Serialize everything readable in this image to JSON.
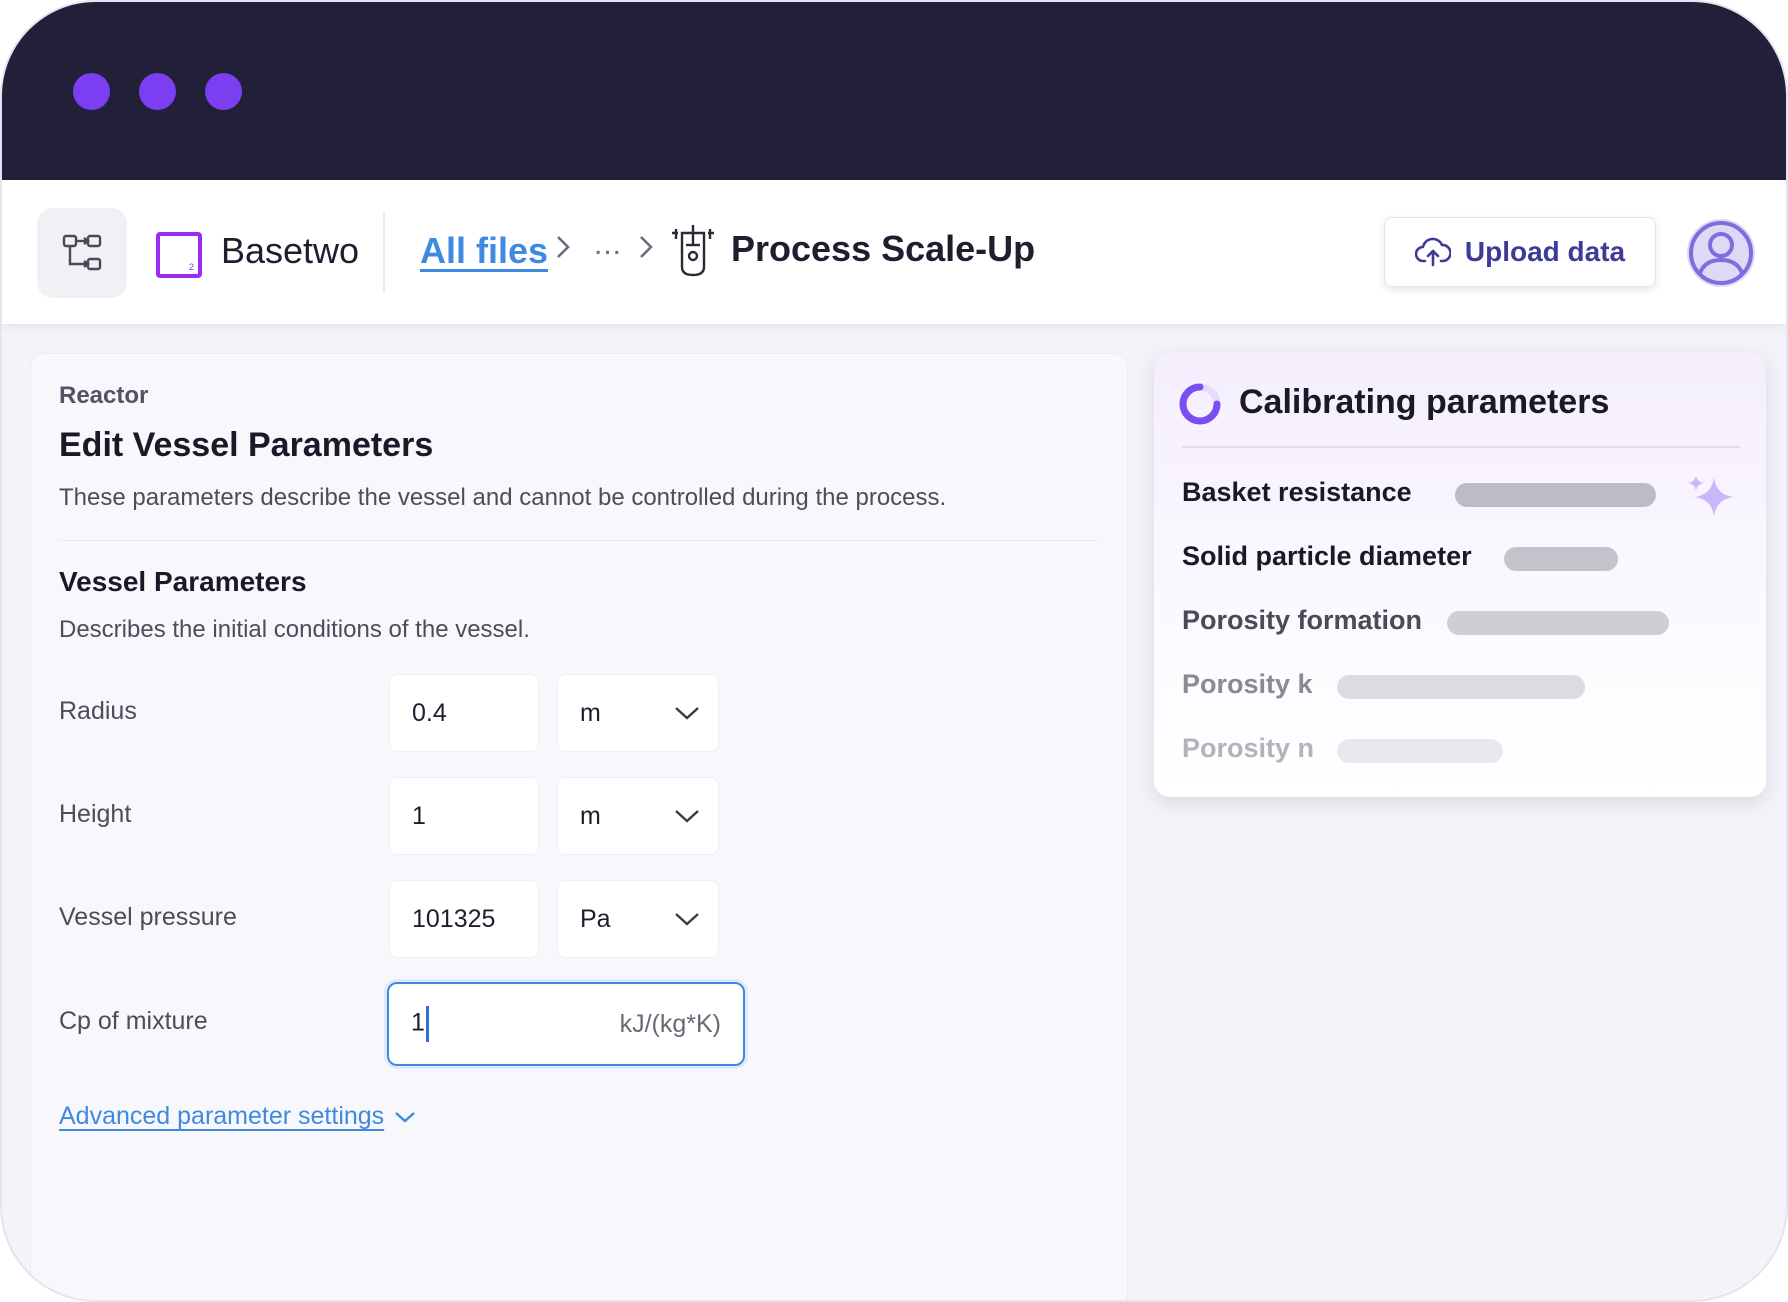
{
  "app": {
    "brand": "Basetwo",
    "logo_digit": "2"
  },
  "breadcrumb": {
    "root": "All files",
    "ellipsis": "...",
    "current": "Process Scale-Up"
  },
  "header": {
    "upload_label": "Upload data"
  },
  "form": {
    "eyebrow": "Reactor",
    "title": "Edit Vessel Parameters",
    "description": "These parameters describe the vessel and cannot be controlled during the process.",
    "section_title": "Vessel Parameters",
    "section_description": "Describes the initial conditions of the vessel.",
    "params": [
      {
        "label": "Radius",
        "value": "0.4",
        "unit": "m"
      },
      {
        "label": "Height",
        "value": "1",
        "unit": "m"
      },
      {
        "label": "Vessel pressure",
        "value": "101325",
        "unit": "Pa"
      },
      {
        "label": "Cp of mixture",
        "value": "1",
        "unit": "kJ/(kg*K)"
      }
    ],
    "advanced_link": "Advanced parameter settings"
  },
  "calibration": {
    "title": "Calibrating parameters",
    "items": [
      {
        "label": "Basket resistance"
      },
      {
        "label": "Solid particle diameter"
      },
      {
        "label": "Porosity formation"
      },
      {
        "label": "Porosity k"
      },
      {
        "label": "Porosity n"
      }
    ]
  },
  "colors": {
    "titlebar": "#221f38",
    "window_dots": "#7b3ef0",
    "brand_accent": "#9a2bf0",
    "link": "#3f8ae0",
    "upload_text": "#3d3a98",
    "avatar": "#7d6ee0"
  },
  "icons": [
    "workflow-icon",
    "chevron-right-icon",
    "reactor-vessel-icon",
    "upload-cloud-icon",
    "user-avatar-icon",
    "chevron-down-icon",
    "spinner-icon",
    "sparkle-icon"
  ]
}
